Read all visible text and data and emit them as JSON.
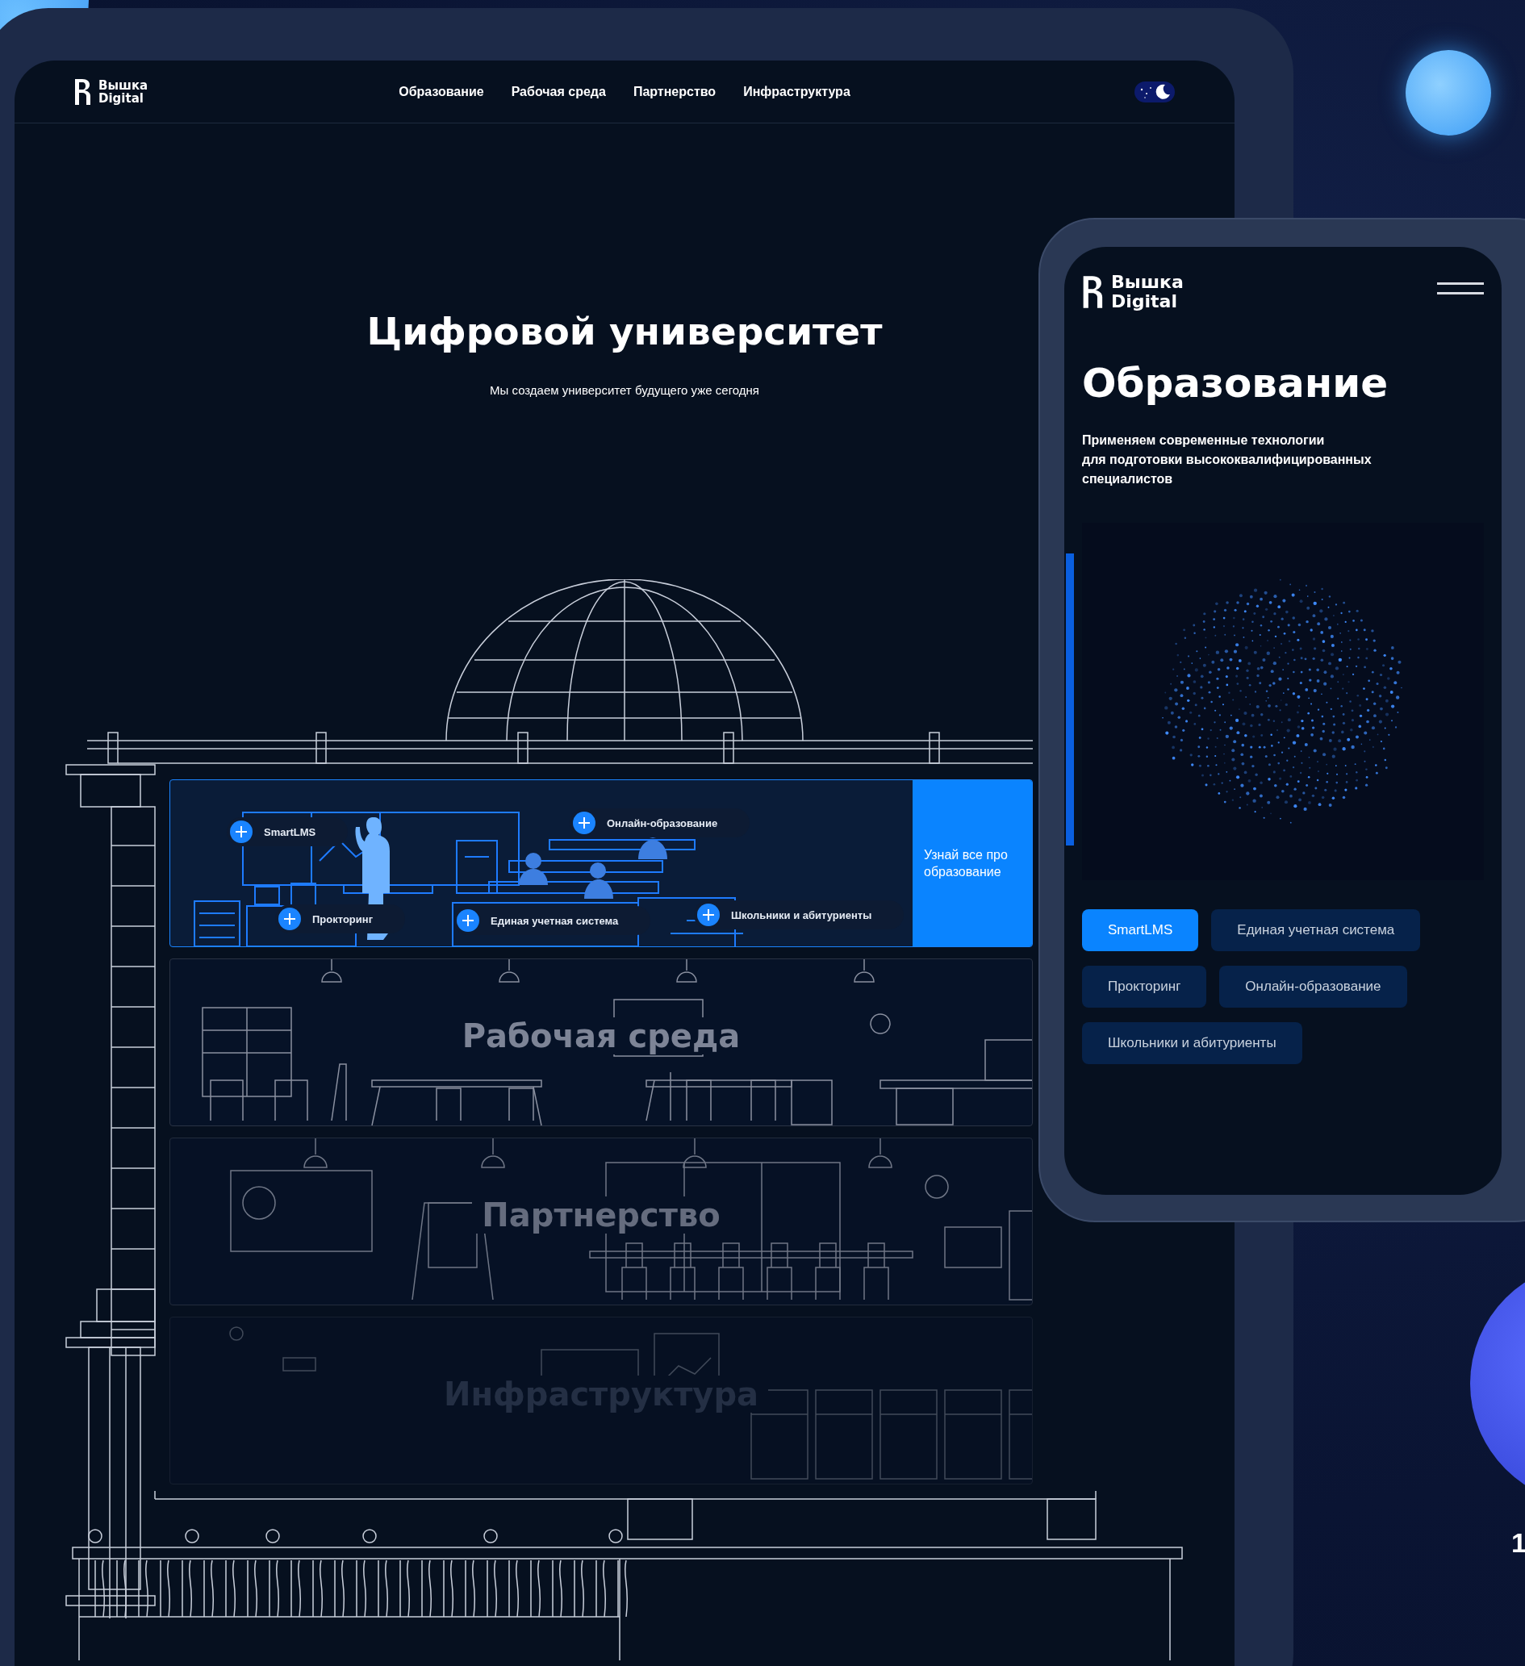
{
  "tablet": {
    "logo": "Вышка Digital",
    "nav": [
      "Образование",
      "Рабочая среда",
      "Партнерство",
      "Инфраструктура"
    ],
    "title": "Цифровой университет",
    "subtitle": "Мы создаем университет будущего уже сегодня",
    "dark_mode": true
  },
  "floors": [
    {
      "kind": "classroom",
      "active": true,
      "hotspots": [
        {
          "label": "SmartLMS"
        },
        {
          "label": "Прокторинг"
        },
        {
          "label": "Единая учетная система"
        },
        {
          "label": "Онлайн-образование"
        },
        {
          "label": "Школьники и абитуриенты"
        }
      ],
      "cta": "Узнай все про образование"
    },
    {
      "kind": "office",
      "active": false,
      "title": "Рабочая среда"
    },
    {
      "kind": "meeting",
      "active": false,
      "title": "Партнерство"
    },
    {
      "kind": "servers",
      "active": false,
      "title": "Инфраструктура"
    }
  ],
  "phone": {
    "logo": "Вышка Digital",
    "title": "Образование",
    "description": "Применяем современные технологии\nдля подготовки высококвалифицированных\nспециалистов",
    "buttons": [
      {
        "label": "SmartLMS",
        "selected": true
      },
      {
        "label": "Единая учетная система",
        "selected": false
      },
      {
        "label": "Прокторинг",
        "selected": false
      },
      {
        "label": "Онлайн-образование",
        "selected": false
      },
      {
        "label": "Школьники и абитуриенты",
        "selected": false
      }
    ]
  },
  "page_number": "1"
}
